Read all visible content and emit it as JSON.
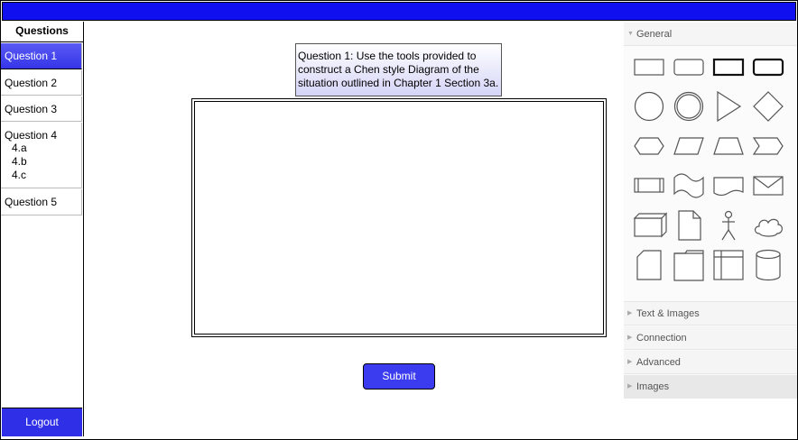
{
  "sidebar": {
    "header": "Questions",
    "items": [
      {
        "label": "Question 1",
        "subitems": []
      },
      {
        "label": "Question 2",
        "subitems": []
      },
      {
        "label": "Question 3",
        "subitems": []
      },
      {
        "label": "Question 4",
        "subitems": [
          "4.a",
          "4.b",
          "4.c"
        ]
      },
      {
        "label": "Question 5",
        "subitems": []
      }
    ],
    "logout_label": "Logout"
  },
  "question": {
    "text": "Question 1: Use the tools provided to construct a Chen style Diagram of the situation outlined in Chapter 1 Section 3a."
  },
  "submit_label": "Submit",
  "panel": {
    "sections": [
      "General",
      "Text & Images",
      "Connection",
      "Advanced",
      "Images"
    ],
    "general_shapes": [
      "rectangle-icon",
      "rounded-rectangle-icon",
      "bold-rectangle-icon",
      "bold-rounded-rectangle-icon",
      "ellipse-icon",
      "double-ellipse-icon",
      "triangle-icon",
      "diamond-icon",
      "hexagon-icon",
      "parallelogram-icon",
      "trapezoid-icon",
      "step-icon",
      "process-icon",
      "tape-icon",
      "document-wave-icon",
      "envelope-icon",
      "cube-icon",
      "note-icon",
      "actor-icon",
      "cloud-icon",
      "card-icon",
      "folder-icon",
      "internal-storage-icon",
      "cylinder-icon"
    ]
  },
  "colors": {
    "topbar": "#0f0ff0",
    "active_item": "#3535e8",
    "button": "#3b3bef"
  }
}
